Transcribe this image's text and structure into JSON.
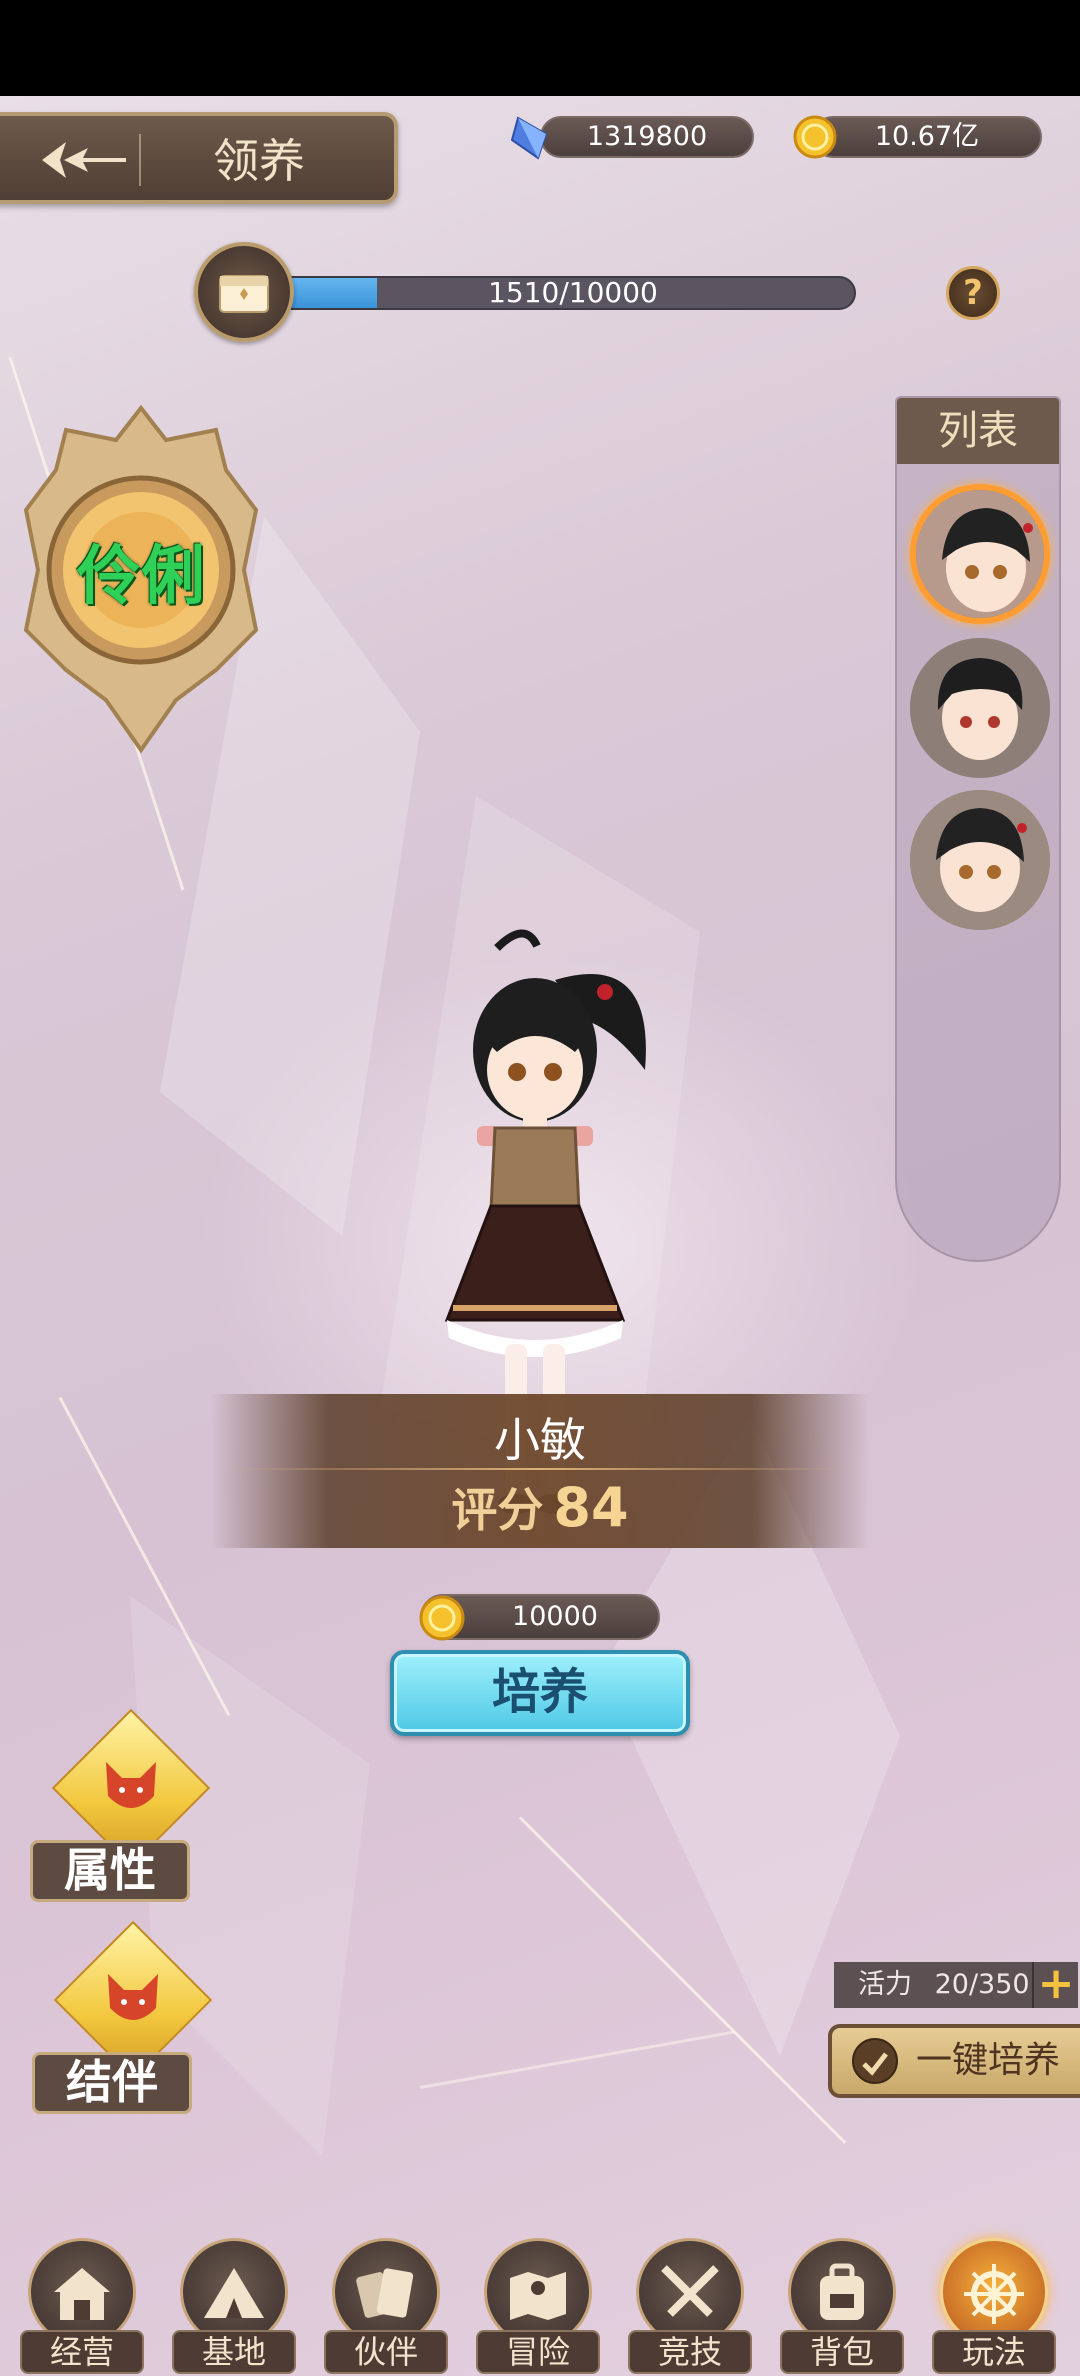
{
  "header": {
    "title": "领养",
    "back_icon": "back-arrow-icon"
  },
  "currencies": {
    "gems": {
      "icon": "blue-gem-icon",
      "value": "1319800"
    },
    "gold": {
      "icon": "gold-coin-icon",
      "value": "10.67亿"
    }
  },
  "progress": {
    "icon": "treasure-chest-icon",
    "text": "1510/10000",
    "fraction": 0.151,
    "help": "?"
  },
  "emblem": {
    "text": "伶俐"
  },
  "list": {
    "title": "列表",
    "items": [
      {
        "name": "portrait-girl-pigtail",
        "selected": true
      },
      {
        "name": "portrait-boy",
        "selected": false
      },
      {
        "name": "portrait-girl-pigtail-2",
        "selected": false
      }
    ]
  },
  "character": {
    "name": "小敏",
    "score_label": "评分",
    "score": "84"
  },
  "cultivate": {
    "cost": "10000",
    "cost_icon": "gold-coin-icon",
    "button_label": "培养"
  },
  "side_buttons": {
    "attributes": "属性",
    "partner": "结伴"
  },
  "energy": {
    "label": "活力",
    "value": "20/350",
    "plus": "+"
  },
  "one_click": {
    "label": "一键培养"
  },
  "nav": [
    {
      "label": "经营",
      "icon": "house-icon",
      "active": false
    },
    {
      "label": "基地",
      "icon": "tent-icon",
      "active": false
    },
    {
      "label": "伙伴",
      "icon": "cards-icon",
      "active": false
    },
    {
      "label": "冒险",
      "icon": "map-icon",
      "active": false
    },
    {
      "label": "竞技",
      "icon": "crossed-swords-icon",
      "active": false
    },
    {
      "label": "背包",
      "icon": "backpack-icon",
      "active": false
    },
    {
      "label": "玩法",
      "icon": "ship-wheel-icon",
      "active": true
    }
  ],
  "colors": {
    "accent_gold": "#f3c23e",
    "progress_blue": "#3a92d8",
    "cultivate_cyan": "#4ec8e6",
    "panel_brown": "#5d4a41",
    "selected_orange": "#ff9d32"
  }
}
